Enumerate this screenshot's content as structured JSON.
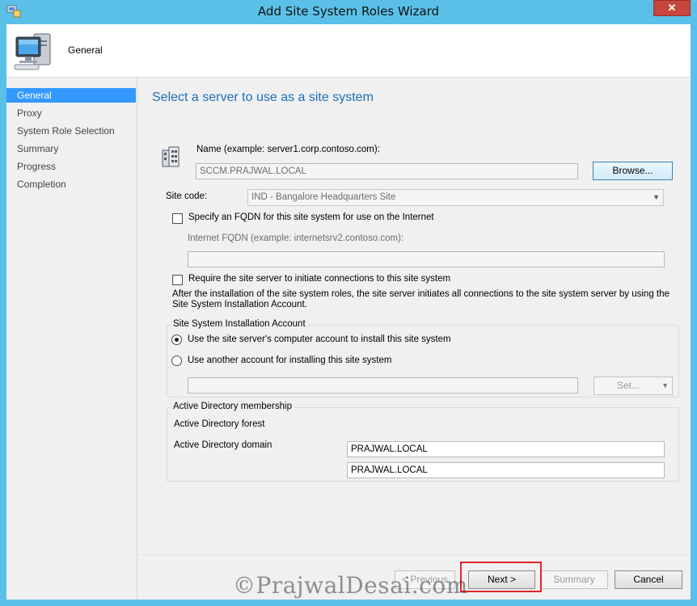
{
  "window": {
    "title": "Add Site System Roles Wizard",
    "close_label": "✕"
  },
  "header": {
    "title": "General"
  },
  "nav": {
    "items": [
      {
        "label": "General",
        "active": true
      },
      {
        "label": "Proxy"
      },
      {
        "label": "System Role Selection"
      },
      {
        "label": "Summary"
      },
      {
        "label": "Progress"
      },
      {
        "label": "Completion"
      }
    ]
  },
  "page": {
    "title": "Select a server to use as a site system",
    "name_label": "Name (example: server1.corp.contoso.com):",
    "name_value": "SCCM.PRAJWAL.LOCAL",
    "browse_label": "Browse...",
    "site_code_label": "Site code:",
    "site_code_value": "IND - Bangalore Headquarters Site",
    "fqdn_checkbox_label": "Specify an FQDN for this site system for use on the Internet",
    "internet_fqdn_label": "Internet FQDN (example: internetsrv2.contoso.com):",
    "internet_fqdn_value": "",
    "require_checkbox_label": "Require the site server to initiate connections to this site system",
    "info_text": "After the  installation of the site system roles, the site server initiates all connections to the site system server by using the Site System Installation Account.",
    "install_account": {
      "group_label": "Site System Installation Account",
      "option1": "Use the site server's computer account to install this site system",
      "option2": "Use another account for installing this site system",
      "account_value": "",
      "set_label": "Set..."
    },
    "ad": {
      "group_label": "Active Directory membership",
      "forest_label": "Active Directory forest",
      "forest_value": "PRAJWAL.LOCAL",
      "domain_label": "Active Directory domain",
      "domain_value": "PRAJWAL.LOCAL"
    }
  },
  "footer": {
    "previous": "< Previous",
    "next": "Next >",
    "summary": "Summary",
    "cancel": "Cancel"
  },
  "watermark": "©PrajwalDesai.com",
  "colors": {
    "accent": "#3399ff",
    "titlebar": "#5bc0e8",
    "heading": "#1e6fb4",
    "highlight": "#e0262c"
  }
}
